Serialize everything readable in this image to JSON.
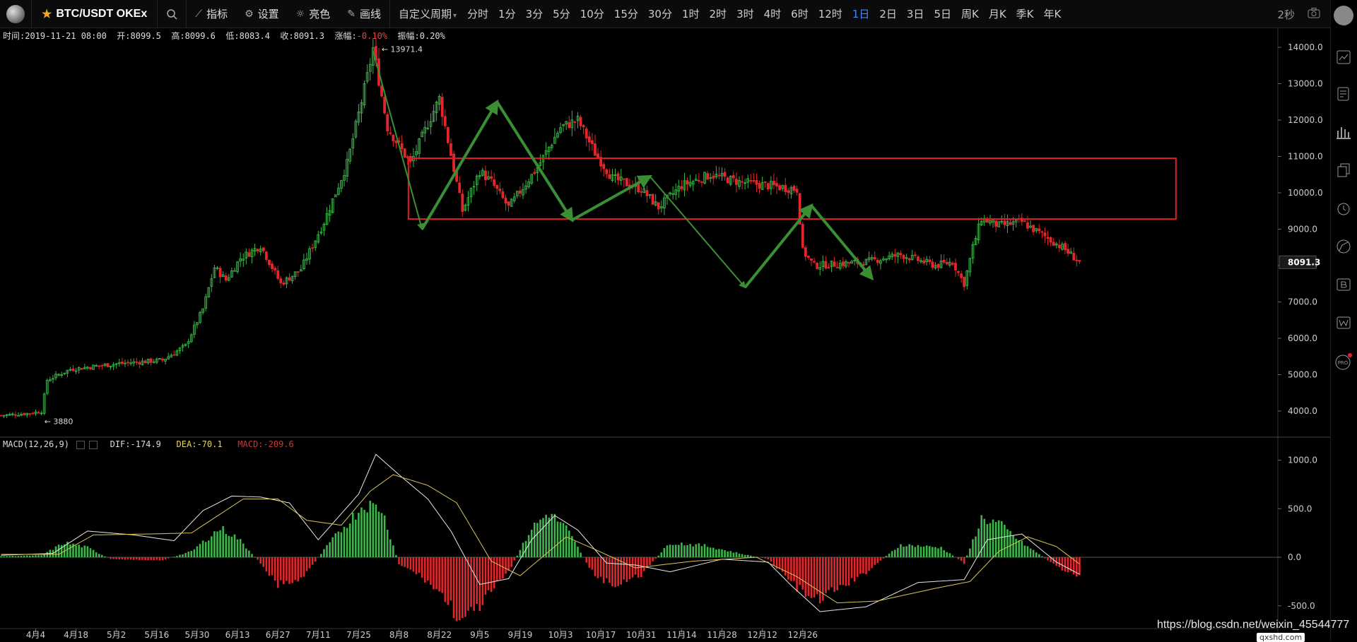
{
  "toolbar": {
    "symbol": "BTC/USDT OKEx",
    "indicators_label": "指标",
    "settings_label": "设置",
    "theme_label": "亮色",
    "draw_label": "画线",
    "custom_period_label": "自定义周期",
    "periods": [
      "分时",
      "1分",
      "3分",
      "5分",
      "10分",
      "15分",
      "30分",
      "1时",
      "2时",
      "3时",
      "4时",
      "6时",
      "12时",
      "1日",
      "2日",
      "3日",
      "5日",
      "周K",
      "月K",
      "季K",
      "年K"
    ],
    "active_period": "1日",
    "refresh": "2秒"
  },
  "ohlc": {
    "time_label": "时间:",
    "time": "2019-11-21 08:00",
    "open_label": "开:",
    "open": "8099.5",
    "high_label": "高:",
    "high": "8099.6",
    "low_label": "低:",
    "low": "8083.4",
    "close_label": "收:",
    "close": "8091.3",
    "change_label": "涨幅:",
    "change": "-0.10%",
    "amplitude_label": "振幅:",
    "amplitude": "0.20%"
  },
  "macd_legend": {
    "name": "MACD(12,26,9)",
    "dif": "DIF:-174.9",
    "dea": "DEA:-70.1",
    "macd": "MACD:-209.6"
  },
  "price_axis": [
    "14000.0",
    "13000.0",
    "12000.0",
    "11000.0",
    "10000.0",
    "9000.0",
    "8000.0",
    "7000.0",
    "6000.0",
    "5000.0",
    "4000.0"
  ],
  "macd_axis": [
    "1000.0",
    "500.0",
    "0.0",
    "-500.0"
  ],
  "current_price": "8091.3",
  "max_label": "13971.4",
  "min_label": "3880",
  "date_labels": [
    "4月4",
    "4月18",
    "5月2",
    "5月16",
    "5月30",
    "6月13",
    "6月27",
    "7月11",
    "7月25",
    "8月8",
    "8月22",
    "9月5",
    "9月19",
    "10月3",
    "10月17",
    "10月31",
    "11月14",
    "11月28",
    "12月12",
    "12月26"
  ],
  "colors": {
    "up": "#3cb54a",
    "down": "#e2262b",
    "arrow": "#3a8f35",
    "box": "#e21d25",
    "active": "#3d8bfd"
  },
  "watermark": "https://blog.csdn.net/weixin_45544777",
  "watermark2": "qxshd.com",
  "chart_data": {
    "type": "candlestick",
    "x_range": [
      "2019-03-23",
      "2019-11-21"
    ],
    "ylim": [
      3600,
      14300
    ],
    "price_path": [
      [
        0,
        3880
      ],
      [
        10,
        3940
      ],
      [
        14,
        3990
      ],
      [
        16,
        4850
      ],
      [
        24,
        5150
      ],
      [
        40,
        5300
      ],
      [
        56,
        5400
      ],
      [
        64,
        5800
      ],
      [
        70,
        6800
      ],
      [
        74,
        7950
      ],
      [
        78,
        7600
      ],
      [
        83,
        8200
      ],
      [
        90,
        8550
      ],
      [
        97,
        7500
      ],
      [
        104,
        7900
      ],
      [
        112,
        9200
      ],
      [
        120,
        10800
      ],
      [
        127,
        13200
      ],
      [
        129,
        13971.4
      ],
      [
        134,
        11800
      ],
      [
        142,
        10800
      ],
      [
        148,
        11900
      ],
      [
        152,
        12600
      ],
      [
        160,
        9500
      ],
      [
        166,
        10600
      ],
      [
        170,
        10300
      ],
      [
        176,
        9600
      ],
      [
        186,
        10700
      ],
      [
        194,
        11800
      ],
      [
        200,
        12000
      ],
      [
        206,
        11100
      ],
      [
        212,
        10400
      ],
      [
        222,
        10100
      ],
      [
        228,
        9600
      ],
      [
        236,
        10200
      ],
      [
        246,
        10500
      ],
      [
        256,
        10300
      ],
      [
        266,
        10200
      ],
      [
        276,
        10100
      ],
      [
        278,
        8400
      ],
      [
        282,
        8000
      ],
      [
        300,
        8100
      ],
      [
        312,
        8300
      ],
      [
        324,
        8000
      ],
      [
        330,
        8100
      ],
      [
        334,
        7500
      ],
      [
        337,
        8500
      ],
      [
        340,
        9300
      ],
      [
        346,
        9100
      ],
      [
        354,
        9200
      ],
      [
        360,
        8900
      ],
      [
        368,
        8500
      ],
      [
        374,
        8100
      ]
    ],
    "macd_hist": [
      [
        0,
        10
      ],
      [
        14,
        20
      ],
      [
        22,
        150
      ],
      [
        30,
        100
      ],
      [
        38,
        -20
      ],
      [
        56,
        -30
      ],
      [
        66,
        60
      ],
      [
        76,
        300
      ],
      [
        82,
        200
      ],
      [
        90,
        -60
      ],
      [
        96,
        -280
      ],
      [
        104,
        -230
      ],
      [
        114,
        150
      ],
      [
        126,
        550
      ],
      [
        132,
        500
      ],
      [
        138,
        -70
      ],
      [
        146,
        -200
      ],
      [
        154,
        -420
      ],
      [
        160,
        -680
      ],
      [
        166,
        -500
      ],
      [
        176,
        -150
      ],
      [
        184,
        300
      ],
      [
        190,
        460
      ],
      [
        196,
        300
      ],
      [
        206,
        -200
      ],
      [
        214,
        -300
      ],
      [
        222,
        -180
      ],
      [
        232,
        150
      ],
      [
        244,
        120
      ],
      [
        256,
        40
      ],
      [
        266,
        -20
      ],
      [
        276,
        -310
      ],
      [
        282,
        -460
      ],
      [
        298,
        -200
      ],
      [
        312,
        130
      ],
      [
        326,
        100
      ],
      [
        334,
        -60
      ],
      [
        340,
        400
      ],
      [
        346,
        350
      ],
      [
        354,
        150
      ],
      [
        366,
        -90
      ],
      [
        374,
        -210
      ]
    ],
    "dif": [
      [
        0,
        20
      ],
      [
        18,
        40
      ],
      [
        30,
        270
      ],
      [
        46,
        230
      ],
      [
        60,
        170
      ],
      [
        70,
        480
      ],
      [
        80,
        630
      ],
      [
        90,
        620
      ],
      [
        100,
        560
      ],
      [
        110,
        180
      ],
      [
        124,
        650
      ],
      [
        130,
        1060
      ],
      [
        138,
        850
      ],
      [
        148,
        600
      ],
      [
        156,
        270
      ],
      [
        166,
        -280
      ],
      [
        176,
        -220
      ],
      [
        184,
        180
      ],
      [
        192,
        430
      ],
      [
        200,
        280
      ],
      [
        210,
        -60
      ],
      [
        220,
        -80
      ],
      [
        232,
        -150
      ],
      [
        250,
        -20
      ],
      [
        266,
        -50
      ],
      [
        274,
        -290
      ],
      [
        284,
        -560
      ],
      [
        300,
        -510
      ],
      [
        318,
        -260
      ],
      [
        334,
        -230
      ],
      [
        342,
        180
      ],
      [
        354,
        240
      ],
      [
        366,
        -50
      ],
      [
        374,
        -175
      ]
    ],
    "dea": [
      [
        0,
        30
      ],
      [
        20,
        30
      ],
      [
        32,
        230
      ],
      [
        52,
        240
      ],
      [
        66,
        250
      ],
      [
        84,
        600
      ],
      [
        96,
        600
      ],
      [
        106,
        380
      ],
      [
        118,
        330
      ],
      [
        128,
        680
      ],
      [
        136,
        850
      ],
      [
        148,
        740
      ],
      [
        158,
        560
      ],
      [
        170,
        -40
      ],
      [
        180,
        -190
      ],
      [
        196,
        210
      ],
      [
        206,
        80
      ],
      [
        220,
        -110
      ],
      [
        240,
        -40
      ],
      [
        262,
        0
      ],
      [
        276,
        -200
      ],
      [
        290,
        -470
      ],
      [
        304,
        -450
      ],
      [
        324,
        -320
      ],
      [
        336,
        -250
      ],
      [
        346,
        60
      ],
      [
        356,
        210
      ],
      [
        366,
        110
      ],
      [
        374,
        -70
      ]
    ],
    "macd_ylim": [
      -650,
      1150
    ],
    "zone_box": {
      "from_day": 142,
      "to_day": 374,
      "top": 10950,
      "bottom": 9280
    }
  }
}
